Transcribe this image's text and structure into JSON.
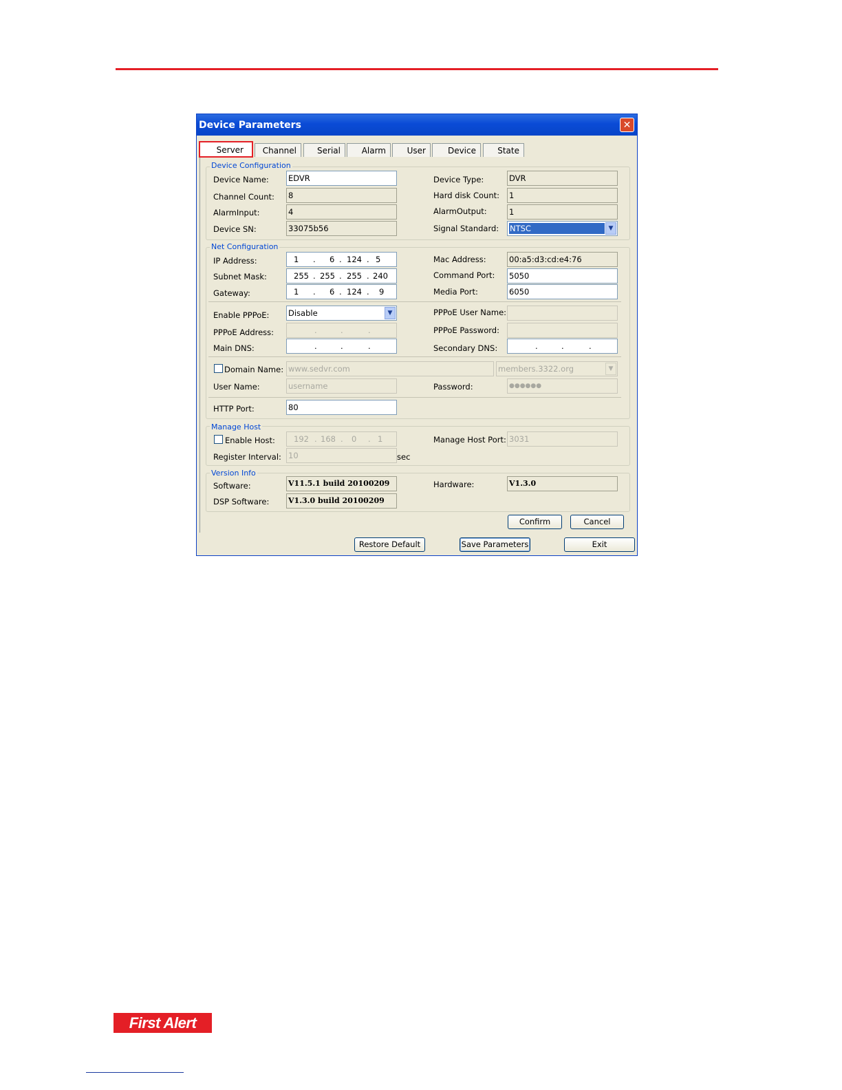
{
  "dialog": {
    "title": "Device Parameters",
    "close_label": "✕"
  },
  "tabs": [
    "Server",
    "Channel",
    "Serial",
    "Alarm",
    "User",
    "Device",
    "State"
  ],
  "device_config": {
    "title": "Device Configuration",
    "device_name_label": "Device Name:",
    "device_name": "EDVR",
    "channel_count_label": "Channel Count:",
    "channel_count": "8",
    "alarm_input_label": "AlarmInput:",
    "alarm_input": "4",
    "device_sn_label": "Device SN:",
    "device_sn": "33075b56",
    "device_type_label": "Device Type:",
    "device_type": "DVR",
    "hdd_count_label": "Hard disk Count:",
    "hdd_count": "1",
    "alarm_output_label": "AlarmOutput:",
    "alarm_output": "1",
    "signal_label": "Signal Standard:",
    "signal": "NTSC"
  },
  "net_config": {
    "title": "Net Configuration",
    "ip_label": "IP Address:",
    "ip": [
      "1",
      "6",
      "124",
      "5"
    ],
    "mask_label": "Subnet Mask:",
    "mask": [
      "255",
      "255",
      "255",
      "240"
    ],
    "gateway_label": "Gateway:",
    "gateway": [
      "1",
      "6",
      "124",
      "9"
    ],
    "mac_label": "Mac Address:",
    "mac": "00:a5:d3:cd:e4:76",
    "cmd_port_label": "Command Port:",
    "cmd_port": "5050",
    "media_port_label": "Media Port:",
    "media_port": "6050",
    "pppoe_enable_label": "Enable PPPoE:",
    "pppoe_enable": "Disable",
    "pppoe_addr_label": "PPPoE Address:",
    "main_dns_label": "Main DNS:",
    "pppoe_user_label": "PPPoE User Name:",
    "pppoe_pass_label": "PPPoE Password:",
    "sec_dns_label": "Secondary DNS:",
    "domain_label": "Domain Name:",
    "domain": "www.sedvr.com",
    "domain_server": "members.3322.org",
    "user_label": "User Name:",
    "user": "username",
    "password_label": "Password:",
    "password": "●●●●●●",
    "http_label": "HTTP Port:",
    "http": "80"
  },
  "manage_host": {
    "title": "Manage Host",
    "enable_label": "Enable Host:",
    "host_ip": [
      "192",
      "168",
      "0",
      "1"
    ],
    "port_label": "Manage Host Port:",
    "port": "3031",
    "interval_label": "Register Interval:",
    "interval": "10",
    "interval_unit": "sec"
  },
  "version": {
    "title": "Version Info",
    "software_label": "Software:",
    "software": "V11.5.1 build 20100209",
    "dsp_label": "DSP Software:",
    "dsp": "V1.3.0 build 20100209",
    "hardware_label": "Hardware:",
    "hardware": "V1.3.0"
  },
  "buttons": {
    "confirm": "Confirm",
    "cancel": "Cancel",
    "restore": "Restore Default",
    "save": "Save Parameters",
    "exit": "Exit"
  },
  "logo": "First Alert"
}
